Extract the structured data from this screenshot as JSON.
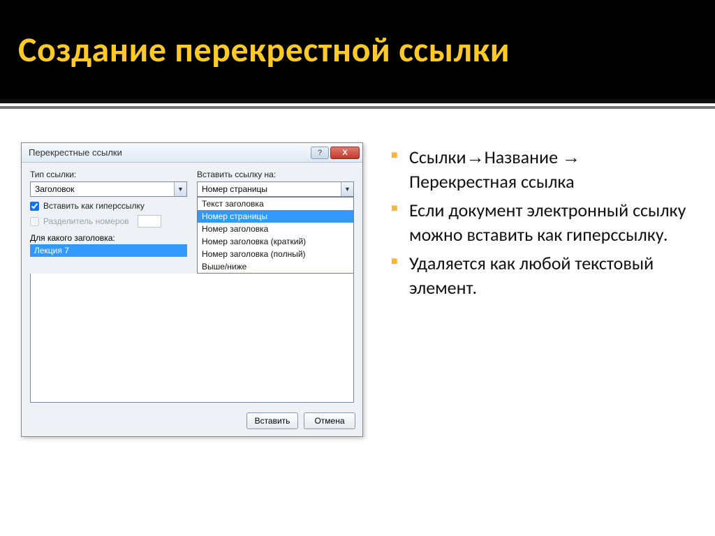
{
  "slide": {
    "title": "Создание перекрестной ссылки"
  },
  "dialog": {
    "title": "Перекрестные ссылки",
    "type_label": "Тип ссылки:",
    "type_value": "Заголовок",
    "insert_label": "Вставить ссылку на:",
    "insert_value": "Номер страницы",
    "hyperlink_checkbox": "Вставить как гиперссылку",
    "separator_checkbox": "Разделитель номеров",
    "for_heading_label": "Для какого заголовка:",
    "heading_item": "Лекция 7",
    "dropdown_options": [
      "Текст заголовка",
      "Номер страницы",
      "Номер заголовка",
      "Номер заголовка (краткий)",
      "Номер заголовка (полный)",
      "Выше/ниже"
    ],
    "insert_button": "Вставить",
    "cancel_button": "Отмена",
    "help_button": "?",
    "close_button": "X"
  },
  "notes": {
    "items": [
      "Ссылки→Название → Перекрестная ссылка",
      "Если документ электронный ссылку можно вставить как гиперссылку.",
      "Удаляется как любой текстовый элемент."
    ]
  }
}
